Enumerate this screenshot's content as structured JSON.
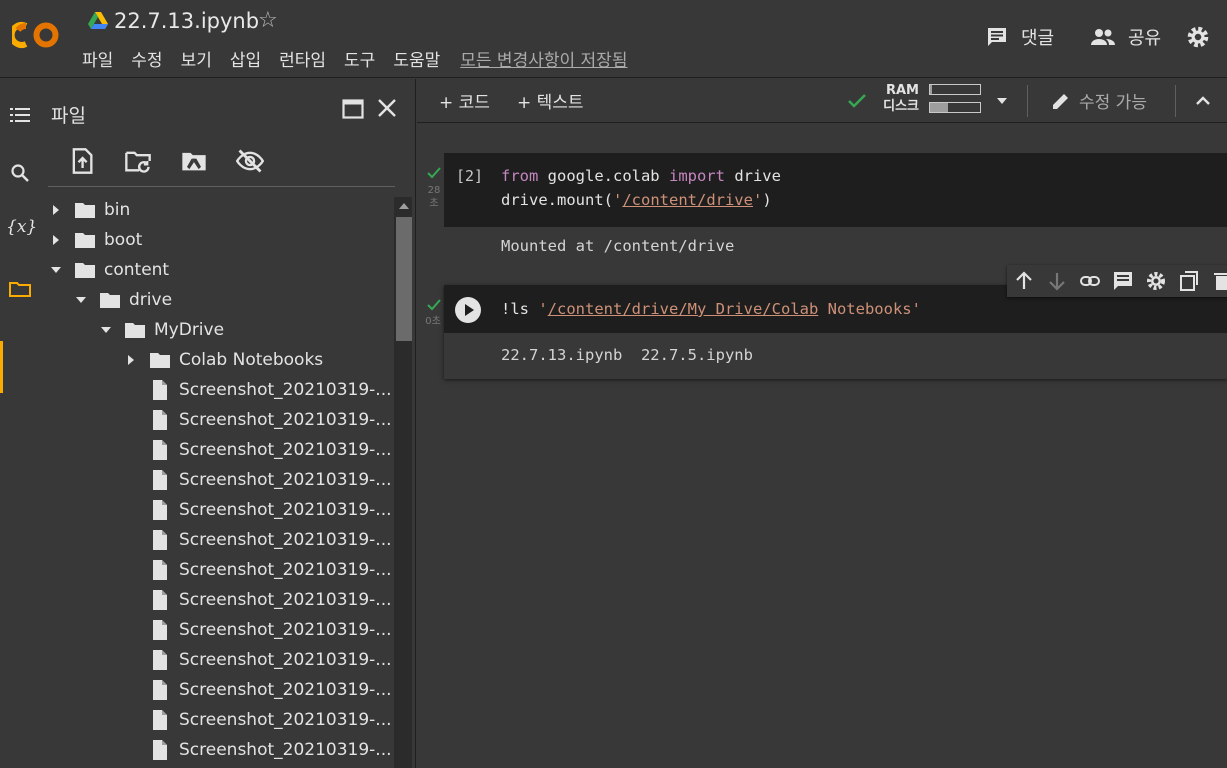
{
  "header": {
    "logo_text": "CO",
    "notebook_title": "22.7.13.ipynb",
    "menu": [
      "파일",
      "수정",
      "보기",
      "삽입",
      "런타임",
      "도구",
      "도움말"
    ],
    "saved_status": "모든 변경사항이 저장됨",
    "comments_label": "댓글",
    "share_label": "공유"
  },
  "files_panel": {
    "title": "파일",
    "tree": [
      {
        "name": "bin",
        "type": "folder",
        "depth": 0,
        "expanded": false
      },
      {
        "name": "boot",
        "type": "folder",
        "depth": 0,
        "expanded": false
      },
      {
        "name": "content",
        "type": "folder",
        "depth": 0,
        "expanded": true
      },
      {
        "name": "drive",
        "type": "folder",
        "depth": 1,
        "expanded": true
      },
      {
        "name": "MyDrive",
        "type": "folder",
        "depth": 2,
        "expanded": true
      },
      {
        "name": "Colab Notebooks",
        "type": "folder",
        "depth": 3,
        "expanded": false
      },
      {
        "name": "Screenshot_20210319-...",
        "type": "file",
        "depth": 3
      },
      {
        "name": "Screenshot_20210319-...",
        "type": "file",
        "depth": 3
      },
      {
        "name": "Screenshot_20210319-...",
        "type": "file",
        "depth": 3
      },
      {
        "name": "Screenshot_20210319-...",
        "type": "file",
        "depth": 3
      },
      {
        "name": "Screenshot_20210319-...",
        "type": "file",
        "depth": 3
      },
      {
        "name": "Screenshot_20210319-...",
        "type": "file",
        "depth": 3
      },
      {
        "name": "Screenshot_20210319-...",
        "type": "file",
        "depth": 3
      },
      {
        "name": "Screenshot_20210319-...",
        "type": "file",
        "depth": 3
      },
      {
        "name": "Screenshot_20210319-...",
        "type": "file",
        "depth": 3
      },
      {
        "name": "Screenshot_20210319-...",
        "type": "file",
        "depth": 3
      },
      {
        "name": "Screenshot_20210319-...",
        "type": "file",
        "depth": 3
      },
      {
        "name": "Screenshot_20210319-...",
        "type": "file",
        "depth": 3
      },
      {
        "name": "Screenshot_20210319-...",
        "type": "file",
        "depth": 3
      }
    ]
  },
  "toolbar": {
    "add_code": "+ 코드",
    "add_text": "+ 텍스트",
    "ram_label": "RAM",
    "disk_label": "디스크",
    "ram_usage": 0.04,
    "disk_usage": 0.35,
    "edit_mode": "수정 가능"
  },
  "cells": {
    "cell1": {
      "exec_count": "[2]",
      "status_time": "28\n초",
      "line1_kw1": "from",
      "line1_mod": " google.colab ",
      "line1_kw2": "import",
      "line1_name": " drive",
      "line2_pre": "drive.mount(",
      "line2_q1": "'",
      "line2_path": "/content/drive",
      "line2_q2": "'",
      "line2_post": ")",
      "output": "Mounted at /content/drive"
    },
    "cell2": {
      "status_time": "0초",
      "code_pre": "!ls ",
      "code_q1": "'",
      "code_path": "/content/drive/My Drive/Colab",
      "code_rest": " Notebooks'",
      "output": "22.7.13.ipynb  22.7.5.ipynb"
    }
  },
  "colors": {
    "accent_orange": "#f9ab00",
    "check_green": "#34a853",
    "keyword": "#c586c0",
    "string": "#ce9178"
  },
  "icons": [
    "toc-icon",
    "search-icon",
    "variables-icon",
    "folder-icon",
    "upload-icon",
    "refresh-folder-icon",
    "mount-drive-icon",
    "hide-files-icon",
    "open-in-tab-icon",
    "close-icon",
    "comment-icon",
    "people-icon",
    "gear-icon",
    "check-icon",
    "pencil-icon",
    "chevron-up-icon",
    "arrow-up-icon",
    "arrow-down-icon",
    "link-icon",
    "cell-comment-icon",
    "cell-settings-icon",
    "mirror-cell-icon",
    "delete-icon",
    "play-icon"
  ]
}
